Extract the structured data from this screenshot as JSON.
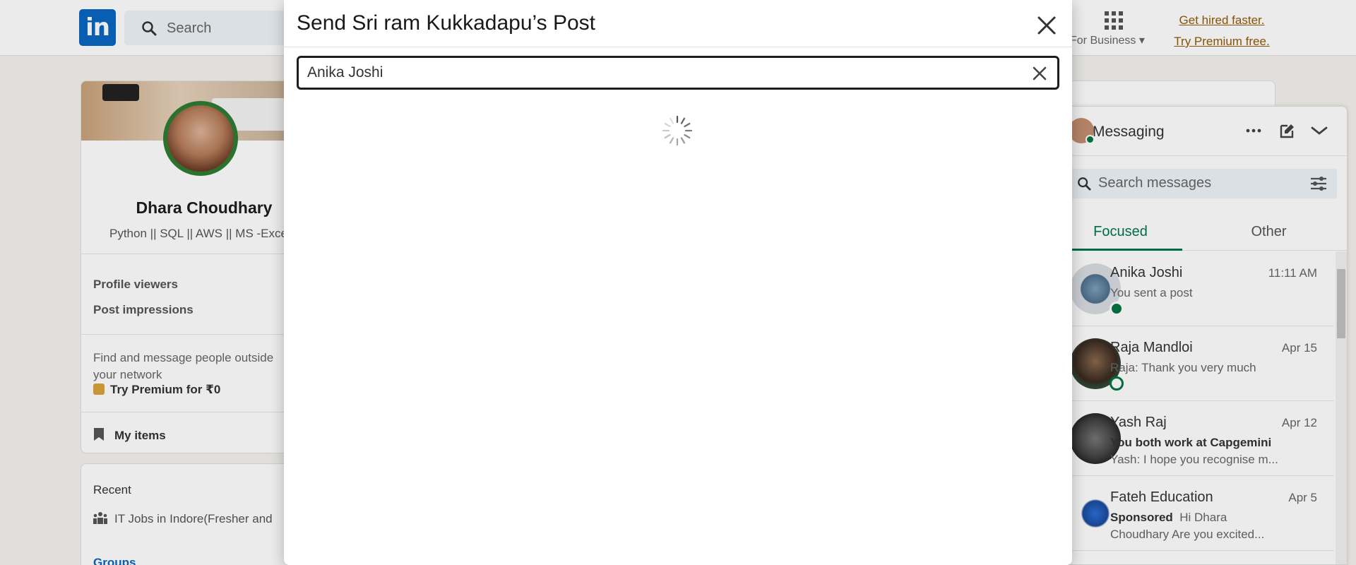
{
  "nav": {
    "logo_text": "in",
    "search_placeholder": "Search",
    "for_business": "For Business",
    "premium_line1": "Get hired faster.",
    "premium_line2": "Try Premium free."
  },
  "profile": {
    "name": "Dhara Choudhary",
    "headline": "Python || SQL || AWS || MS -Exce",
    "stats": [
      "Profile viewers",
      "Post impressions"
    ],
    "find_text": "Find and message people outside your network",
    "try_premium": "Try Premium for ₹0",
    "my_items": "My items"
  },
  "recent": {
    "title": "Recent",
    "item": "IT Jobs in Indore(Fresher and",
    "groups": "Groups"
  },
  "messaging": {
    "title": "Messaging",
    "search_placeholder": "Search messages",
    "tabs": [
      "Focused",
      "Other"
    ],
    "conversations": [
      {
        "name": "Anika Joshi",
        "date": "11:11 AM",
        "line2": "You sent a post",
        "line3": "",
        "status_color": "#057642"
      },
      {
        "name": "Raja Mandloi",
        "date": "Apr 15",
        "line2": "Raja: Thank you very much",
        "line3": "",
        "status_color": "#057642"
      },
      {
        "name": "Yash Raj",
        "date": "Apr 12",
        "line2": "You both work at Capgemini",
        "line3": "Yash: I hope you recognise m...",
        "status_color": ""
      },
      {
        "name": "Fateh Education",
        "date": "Apr 5",
        "sponsored": "Sponsored",
        "line2": "Hi Dhara",
        "line3": "Choudhary Are you excited...",
        "status_color": ""
      }
    ]
  },
  "modal": {
    "title": "Send Sri ram Kukkadapu’s Post",
    "search_value": "Anika Joshi"
  },
  "colors": {
    "brand": "#0a66c2",
    "premium": "#915907",
    "focus_green": "#01754f",
    "online": "#057642"
  }
}
